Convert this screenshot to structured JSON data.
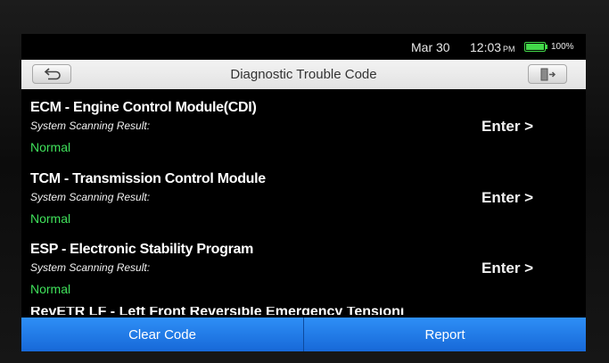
{
  "status_bar": {
    "date": "Mar 30",
    "time": "12:03",
    "ampm": "PM",
    "battery_pct": "100%",
    "battery_level": 1.0,
    "battery_color": "#43d94a"
  },
  "header": {
    "title": "Diagnostic Trouble Code",
    "back_icon": "back-arrow-icon",
    "exit_icon": "exit-door-icon"
  },
  "modules": [
    {
      "name": "ECM - Engine Control Module(CDI)",
      "result_label": "System Scanning Result:",
      "result": "Normal",
      "action": "Enter >"
    },
    {
      "name": "TCM - Transmission Control Module",
      "result_label": "System Scanning Result:",
      "result": "Normal",
      "action": "Enter >"
    },
    {
      "name": "ESP - Electronic Stability Program",
      "result_label": "System Scanning Result:",
      "result": "Normal",
      "action": "Enter >"
    }
  ],
  "partial_item": "RevETR LF - Left Front Reversible Emergency Tensioning",
  "footer": {
    "clear_label": "Clear Code",
    "report_label": "Report",
    "accent_color": "#1f7ae8"
  },
  "colors": {
    "normal_status": "#3fe05a"
  }
}
